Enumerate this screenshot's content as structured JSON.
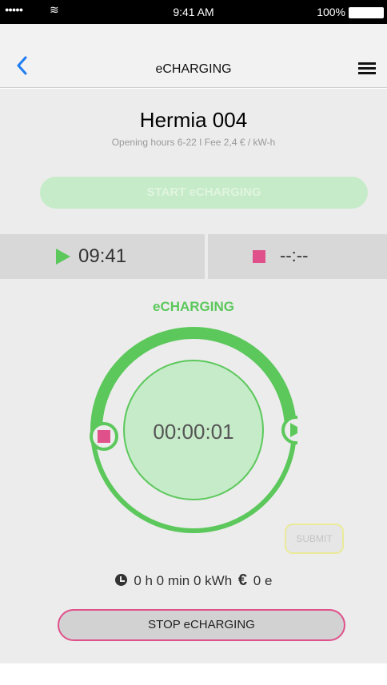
{
  "statusbar": {
    "time": "9:41 AM",
    "battery": "100%",
    "signal": "●●●●●",
    "wifi": "≋"
  },
  "nav": {
    "title": "eCHARGING"
  },
  "station": {
    "name": "Hermia 004",
    "info": "Opening hours 6-22   I   Fee 2,4 € / kW-h"
  },
  "buttons": {
    "start": "START eCHARGING",
    "stop": "STOP eCHARGING",
    "submit": "SUBMIT"
  },
  "schedule": {
    "start_time": "09:41",
    "end_time": "--:--"
  },
  "charging": {
    "label": "eCHARGING",
    "elapsed": "00:00:01"
  },
  "stats": {
    "duration": "0 h 0 min",
    "energy": "0 kWh",
    "cost": "0 e",
    "currency_icon": "€"
  },
  "colors": {
    "accent_green": "#5cc85c",
    "light_green": "#c6ebc8",
    "stop_pink": "#e0508a",
    "back_blue": "#1e7cf2"
  },
  "icons": {
    "back": "chevron-left-icon",
    "menu": "hamburger-menu-icon",
    "play": "play-icon",
    "stop": "stop-icon",
    "clock": "clock-icon",
    "euro": "euro-icon"
  }
}
